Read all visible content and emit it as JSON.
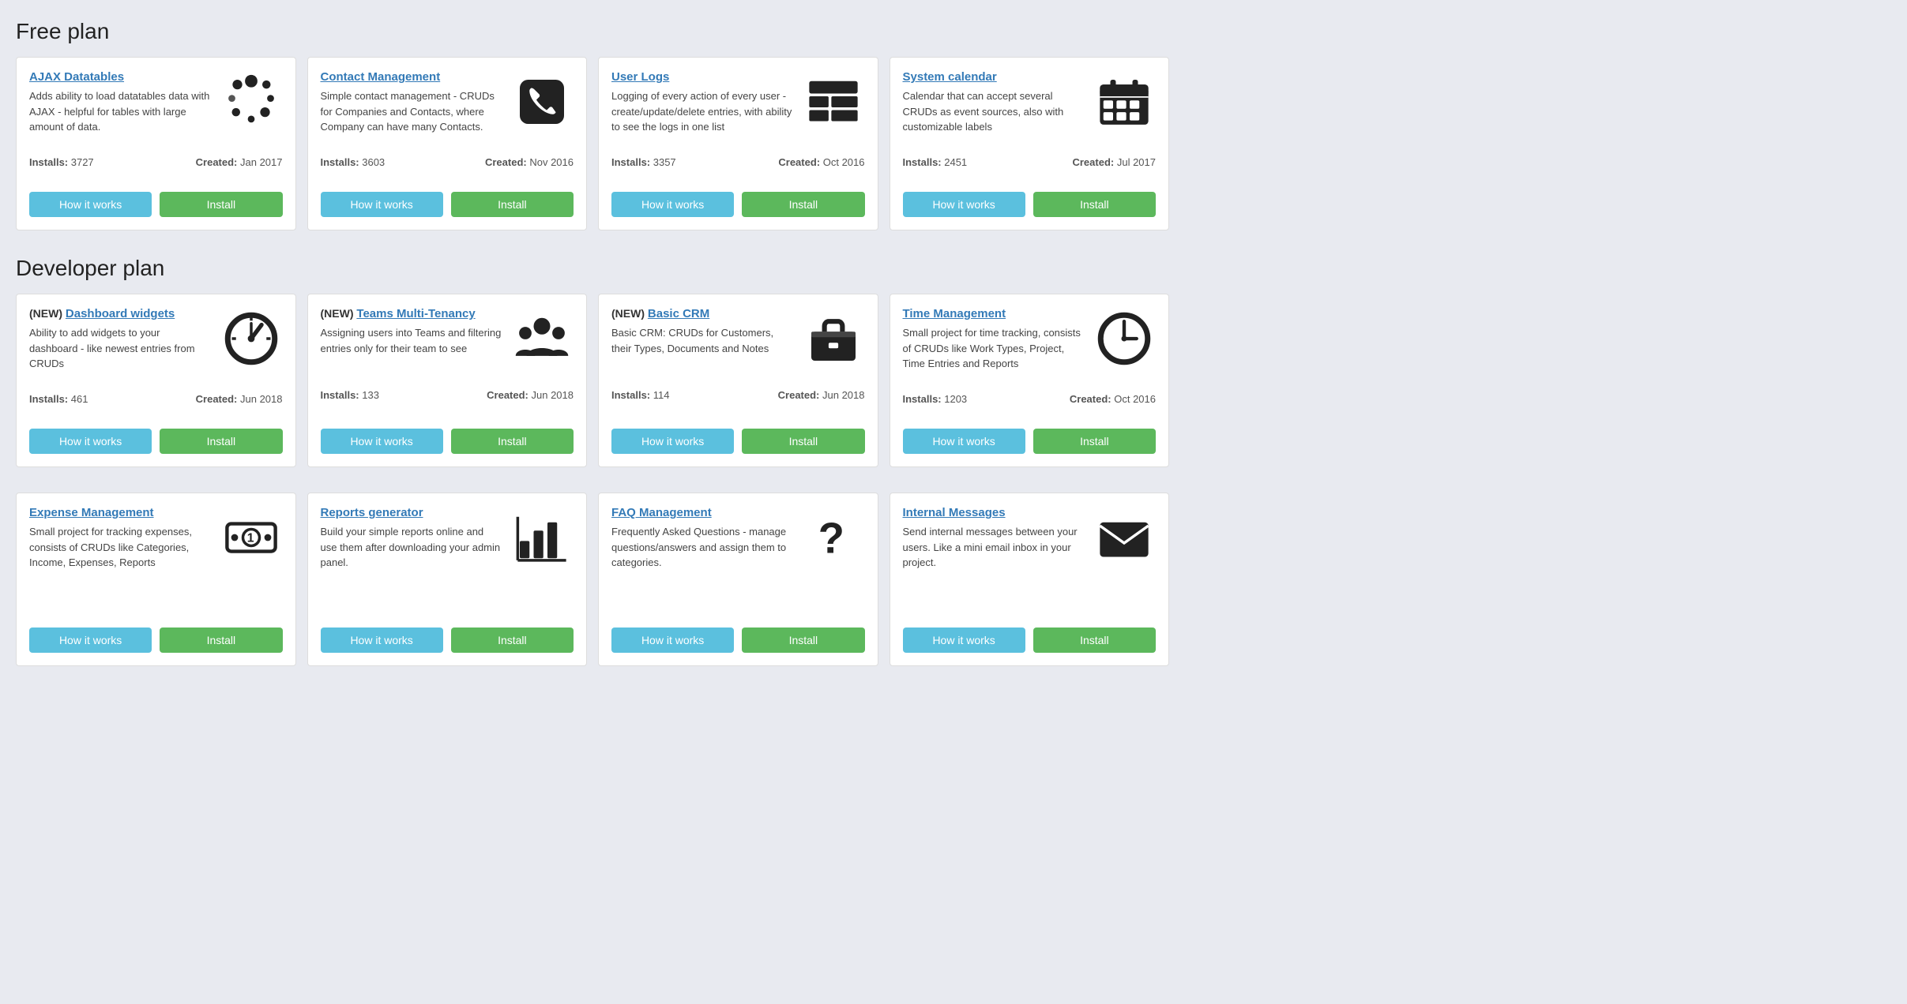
{
  "sections": [
    {
      "title": "Free plan",
      "cards": [
        {
          "id": "ajax-datatables",
          "prefix": "",
          "title": "AJAX Datatables",
          "description": "Adds ability to load datatables data with AJAX - helpful for tables with large amount of data.",
          "installs": "3727",
          "created": "Jan 2017",
          "icon": "spinner",
          "how_label": "How it works",
          "install_label": "Install"
        },
        {
          "id": "contact-management",
          "prefix": "",
          "title": "Contact Management",
          "description": "Simple contact management - CRUDs for Companies and Contacts, where Company can have many Contacts.",
          "installs": "3603",
          "created": "Nov 2016",
          "icon": "phone",
          "how_label": "How it works",
          "install_label": "Install"
        },
        {
          "id": "user-logs",
          "prefix": "",
          "title": "User Logs",
          "description": "Logging of every action of every user - create/update/delete entries, with ability to see the logs in one list",
          "installs": "3357",
          "created": "Oct 2016",
          "icon": "table",
          "how_label": "How it works",
          "install_label": "Install"
        },
        {
          "id": "system-calendar",
          "prefix": "",
          "title": "System calendar",
          "description": "Calendar that can accept several CRUDs as event sources, also with customizable labels",
          "installs": "2451",
          "created": "Jul 2017",
          "icon": "calendar",
          "how_label": "How it works",
          "install_label": "Install"
        }
      ]
    },
    {
      "title": "Developer plan",
      "cards": [
        {
          "id": "dashboard-widgets",
          "prefix": "(NEW) ",
          "title": "Dashboard widgets",
          "description": "Ability to add widgets to your dashboard - like newest entries from CRUDs",
          "installs": "461",
          "created": "Jun 2018",
          "icon": "dashboard",
          "how_label": "How it works",
          "install_label": "Install"
        },
        {
          "id": "teams-multi-tenancy",
          "prefix": "(NEW) ",
          "title": "Teams Multi-Tenancy",
          "description": "Assigning users into Teams and filtering entries only for their team to see",
          "installs": "133",
          "created": "Jun 2018",
          "icon": "team",
          "how_label": "How it works",
          "install_label": "Install"
        },
        {
          "id": "basic-crm",
          "prefix": "(NEW) ",
          "title": "Basic CRM",
          "description": "Basic CRM: CRUDs for Customers, their Types, Documents and Notes",
          "installs": "114",
          "created": "Jun 2018",
          "icon": "briefcase",
          "how_label": "How it works",
          "install_label": "Install"
        },
        {
          "id": "time-management",
          "prefix": "",
          "title": "Time Management",
          "description": "Small project for time tracking, consists of CRUDs like Work Types, Project, Time Entries and Reports",
          "installs": "1203",
          "created": "Oct 2016",
          "icon": "clock",
          "how_label": "How it works",
          "install_label": "Install"
        }
      ]
    },
    {
      "title": "",
      "cards": [
        {
          "id": "expense-management",
          "prefix": "",
          "title": "Expense Management",
          "description": "Small project for tracking expenses, consists of CRUDs like Categories, Income, Expenses, Reports",
          "installs": "",
          "created": "",
          "icon": "money",
          "how_label": "How it works",
          "install_label": "Install"
        },
        {
          "id": "reports-generator",
          "prefix": "",
          "title": "Reports generator",
          "description": "Build your simple reports online and use them after downloading your admin panel.",
          "installs": "",
          "created": "",
          "icon": "chart",
          "how_label": "How it works",
          "install_label": "Install"
        },
        {
          "id": "faq-management",
          "prefix": "",
          "title": "FAQ Management",
          "description": "Frequently Asked Questions - manage questions/answers and assign them to categories.",
          "installs": "",
          "created": "",
          "icon": "question",
          "how_label": "How it works",
          "install_label": "Install"
        },
        {
          "id": "internal-messages",
          "prefix": "",
          "title": "Internal Messages",
          "description": "Send internal messages between your users. Like a mini email inbox in your project.",
          "installs": "",
          "created": "",
          "icon": "envelope",
          "how_label": "How it works",
          "install_label": "Install"
        }
      ]
    }
  ],
  "labels": {
    "installs": "Installs",
    "created": "Created"
  }
}
